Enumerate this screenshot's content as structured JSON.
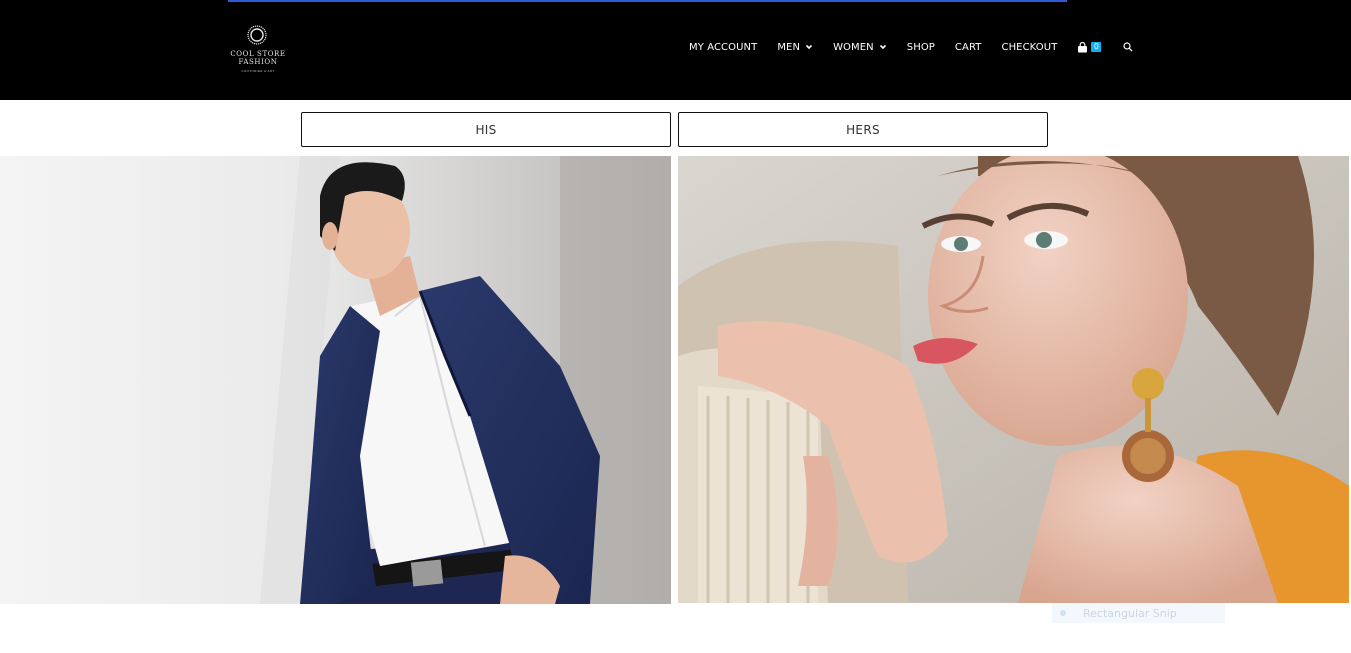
{
  "header": {
    "logo": {
      "line1": "COOL STORE",
      "line2": "FASHION",
      "line3": "COUTURIER & ART"
    },
    "nav": {
      "items": [
        {
          "label": "MY ACCOUNT",
          "has_dropdown": false
        },
        {
          "label": "MEN",
          "has_dropdown": true
        },
        {
          "label": "WOMEN",
          "has_dropdown": true
        },
        {
          "label": "SHOP",
          "has_dropdown": false
        },
        {
          "label": "CART",
          "has_dropdown": false
        },
        {
          "label": "CHECKOUT",
          "has_dropdown": false
        }
      ],
      "cart_count": "0",
      "cart_icon": "shopping-bag-icon",
      "search_icon": "search-icon"
    }
  },
  "gender_buttons": {
    "his": "HIS",
    "hers": "HERS"
  },
  "photos": {
    "his": "man-in-navy-suit-photo",
    "hers": "woman-with-gold-earring-photo"
  },
  "overlay": {
    "snip_label": "Rectangular Snip"
  },
  "colors": {
    "header_bg": "#000000",
    "accent_line": "#2f5bd8",
    "cart_badge": "#13aff0",
    "nav_text": "#ffffff"
  }
}
